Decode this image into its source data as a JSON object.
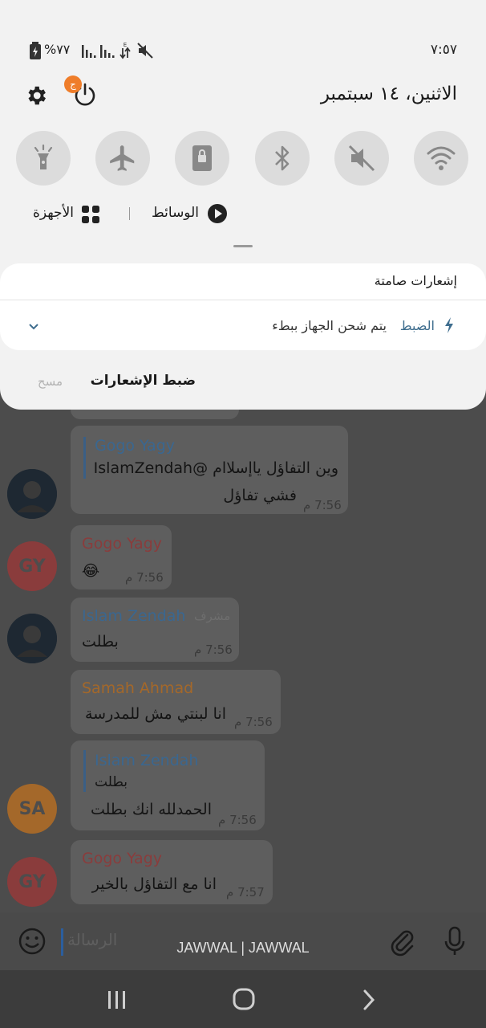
{
  "status_bar": {
    "battery_percent": "%٧٧",
    "time": "٧:٥٧"
  },
  "header": {
    "date": "الاثنين، ١٤ سبتمبر",
    "power_badge": "ج"
  },
  "quick_settings": {
    "media_label": "الوسائط",
    "devices_label": "الأجهزة"
  },
  "notifications": {
    "silent_header": "إشعارات صامتة",
    "charging_app": "الضبط",
    "charging_text": "يتم شحن الجهاز ببطء",
    "settings_button": "ضبط الإشعارات",
    "clear_button": "مسح"
  },
  "chat": {
    "messages": [
      {
        "sender": "Gogo Yagy",
        "line1": "وين التفاؤل ياإسلاام @IslamZendah",
        "line2": "فشي تفاؤل",
        "time": "7:56 م"
      },
      {
        "sender": "Gogo Yagy",
        "text": "😂",
        "time": "7:56 م"
      },
      {
        "sender": "Islam Zendah",
        "badge": "مشرف",
        "text": "بطلت",
        "time": "7:56 م"
      },
      {
        "sender": "Samah Ahmad",
        "text": "انا لبنتي مش للمدرسة",
        "time": "7:56 م"
      },
      {
        "quote_sender": "Islam Zendah",
        "quote_text": "بطلت",
        "text": "الحمدلله انك بطلت",
        "time": "7:56 م"
      },
      {
        "sender": "Gogo Yagy",
        "text": "انا مع التفاؤل بالخير",
        "time": "7:57 م"
      }
    ],
    "avatars": [
      "GY",
      "SA",
      "GY"
    ]
  },
  "input": {
    "placeholder": "الرسالة",
    "carrier": "JAWWAL | JAWWAL"
  },
  "colors": {
    "gogo": "#8a3c3c",
    "islam": "#3a6790",
    "samah": "#a4682a"
  }
}
